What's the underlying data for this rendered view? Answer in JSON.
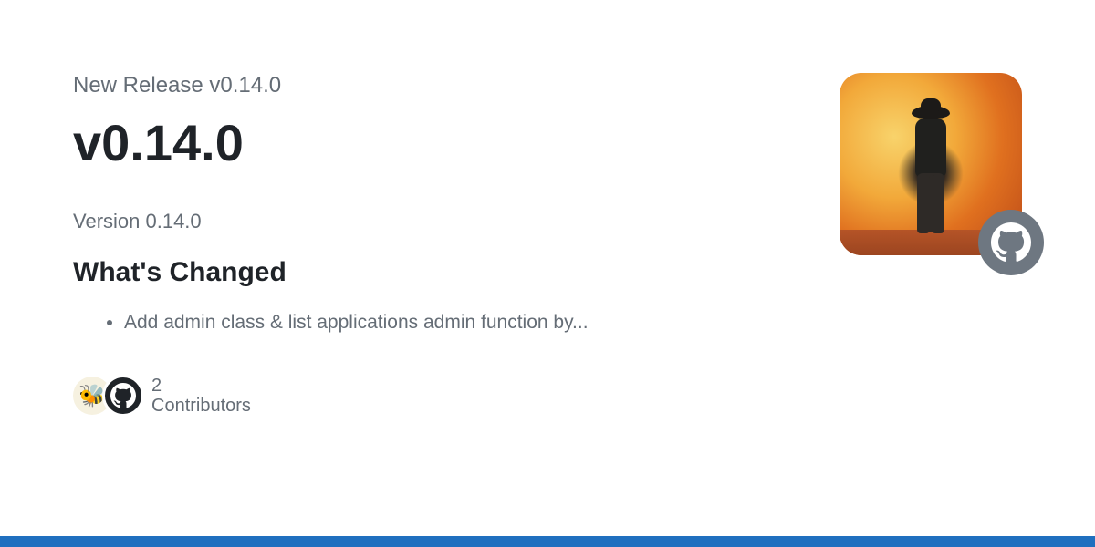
{
  "pre_title": "New Release v0.14.0",
  "title": "v0.14.0",
  "version_line": "Version 0.14.0",
  "section_heading": "What's Changed",
  "changes": [
    "Add admin class & list applications admin function by..."
  ],
  "contributors": {
    "count": "2",
    "label": "Contributors"
  },
  "colors": {
    "accent_bar": "#1f6fbf",
    "text_muted": "#656d76",
    "text": "#1f2328"
  }
}
